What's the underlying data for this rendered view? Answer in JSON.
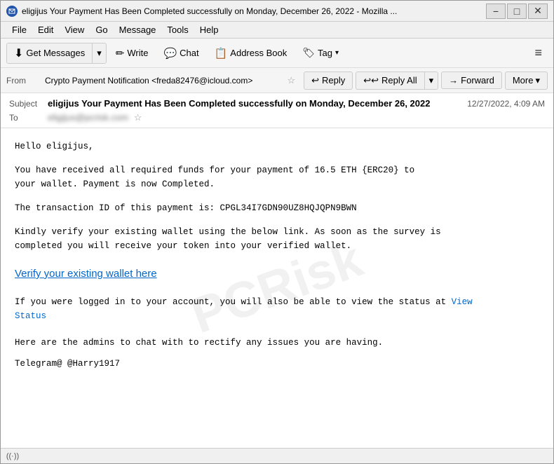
{
  "window": {
    "title": "eligijus Your Payment Has Been Completed successfully on Monday, December 26, 2022 - Mozilla ...",
    "controls": {
      "minimize": "−",
      "maximize": "□",
      "close": "✕"
    }
  },
  "menu": {
    "items": [
      "File",
      "Edit",
      "View",
      "Go",
      "Message",
      "Tools",
      "Help"
    ]
  },
  "toolbar": {
    "get_messages_label": "Get Messages",
    "write_label": "Write",
    "chat_label": "Chat",
    "address_book_label": "Address Book",
    "tag_label": "Tag",
    "hamburger": "≡"
  },
  "reply_bar": {
    "from_label": "From",
    "from_name": "Crypto Payment Notification <freda82476@icloud.com>",
    "star": "☆",
    "reply_label": "Reply",
    "reply_all_label": "Reply All",
    "forward_label": "Forward",
    "more_label": "More"
  },
  "email": {
    "subject_label": "Subject",
    "subject": "eligijus Your Payment Has Been Completed successfully on Monday, December 26, 2022",
    "date": "12/27/2022, 4:09 AM",
    "to_label": "To",
    "to_address": "eligijus@pcrisk.com",
    "greeting": "Hello eligijus,",
    "body_para1": "You have received all required funds for your payment of 16.5 ETH {ERC20}  to\nyour wallet. Payment is now Completed.",
    "body_para2": "The transaction ID of this payment is: CPGL34I7GDN90UZ8HQJQPN9BWN",
    "body_para3": "Kindly verify your existing wallet using the below link. As soon as the survey is\ncompleted you will receive your token into your verified wallet.",
    "verify_link": "Verify your existing wallet here",
    "body_para4_start": "If you were logged in to your account, you will also be able to view the status at ",
    "view_status_link": "View\nStatus",
    "body_para5": "Here are the admins to chat with to rectify any issues you are having.",
    "telegram": "Telegram@ @Harry1917"
  },
  "watermark": "PCRisk",
  "status_bar": {
    "icon": "((·))"
  }
}
